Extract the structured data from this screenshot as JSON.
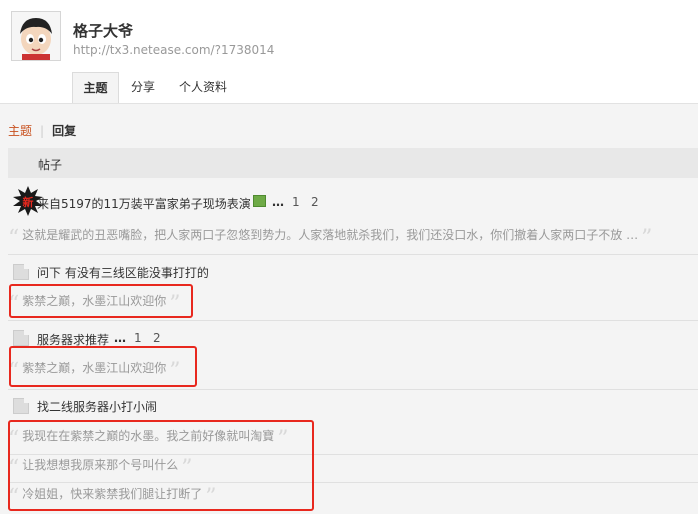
{
  "profile": {
    "name": "格子大爷",
    "url": "http://tx3.netease.com/?1738014"
  },
  "tabs": [
    {
      "label": "主题",
      "active": true
    },
    {
      "label": "分享",
      "active": false
    },
    {
      "label": "个人资料",
      "active": false
    }
  ],
  "filter": {
    "topics": "主题",
    "separator": "|",
    "replies": "回复"
  },
  "table_header": {
    "posts": "帖子"
  },
  "threads": [
    {
      "title": "来自5197的11万装平富家弟子现场表演",
      "ellipsis": "…",
      "pages": [
        "1",
        "2"
      ],
      "badge": "新",
      "has_pic_icon": true,
      "replies": [
        "这就是耀武的丑恶嘴脸，把人家两口子忽悠到势力。人家落地就杀我们，我们还没口水，你们撤着人家两口子不放 …"
      ]
    },
    {
      "title": "问下 有没有三线区能没事打打的",
      "replies": [
        "紫禁之巅，水墨江山欢迎你"
      ]
    },
    {
      "title": "服务器求推荐",
      "ellipsis": "…",
      "pages": [
        "1",
        "2"
      ],
      "replies": [
        "紫禁之巅，水墨江山欢迎你"
      ]
    },
    {
      "title": "找二线服务器小打小闹",
      "replies": [
        "我现在在紫禁之巅的水墨。我之前好像就叫淘寶",
        "让我想想我原来那个号叫什么",
        "冷姐姐，快来紫禁我们腿让打断了"
      ]
    }
  ],
  "quote_marks": {
    "open": "“",
    "close": "”"
  },
  "colors": {
    "accent": "#c8501e",
    "highlight_box": "#e8281e",
    "background": "#f4f4f4",
    "header_bg": "#ffffff"
  }
}
